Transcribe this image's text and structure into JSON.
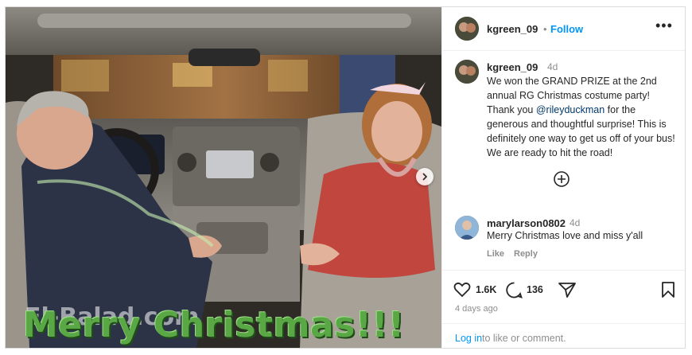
{
  "post": {
    "photo": {
      "overlay_text": "Merry Christmas!!!",
      "watermark": "El-Balad.com"
    },
    "header": {
      "username": "kgreen_09",
      "separator": "•",
      "follow_label": "Follow",
      "more_label": "•••"
    },
    "caption": {
      "username": "kgreen_09",
      "time": "4d",
      "text_before": "We won the GRAND PRIZE at the 2nd annual RG Christmas costume party! Thank you ",
      "mention": "@rileyduckman",
      "text_after": " for the generous and thoughtful surprise! This is definitely one way to get us off of your bus! We are ready to hit the road!"
    },
    "comment": {
      "username": "marylarson0802",
      "time": "4d",
      "text": "Merry Christmas love and miss y'all",
      "like_label": "Like",
      "reply_label": "Reply"
    },
    "actions": {
      "likes": "1.6K",
      "comments": "136",
      "posted_ago": "4 days ago"
    },
    "login": {
      "link": "Log in",
      "text": "to like or comment."
    }
  },
  "colors": {
    "accent": "#0095f6",
    "text": "#262626",
    "muted": "#8e8e8e",
    "overlay_green": "#5aa845"
  },
  "icons": [
    "chevron-right-icon",
    "more-icon",
    "add-circle-icon",
    "heart-icon",
    "comment-icon",
    "share-icon",
    "bookmark-icon"
  ]
}
